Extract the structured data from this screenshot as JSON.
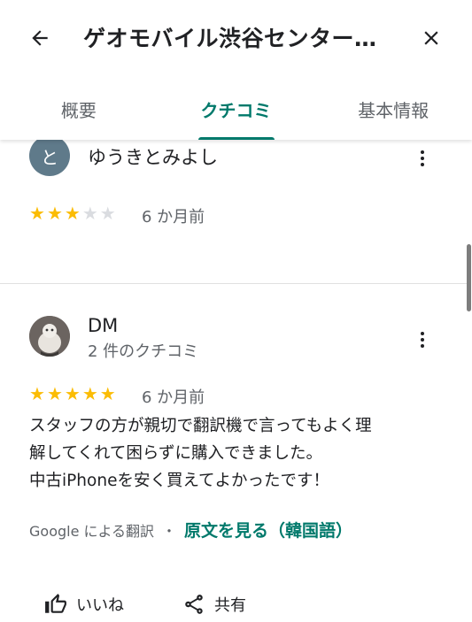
{
  "header": {
    "title": "ゲオモバイル渋谷センター…"
  },
  "tabs": [
    {
      "label": "概要"
    },
    {
      "label": "クチコミ"
    },
    {
      "label": "基本情報"
    }
  ],
  "reviews": [
    {
      "avatar_letter": "と",
      "name": "ゆうきとみよし",
      "rating": 3,
      "max_rating": 5,
      "time": "6 か月前"
    },
    {
      "avatar_icon": "profile-photo",
      "name": "DM",
      "review_count": "2 件のクチコミ",
      "rating": 5,
      "max_rating": 5,
      "time": "6 か月前",
      "text_lines": [
        "スタッフの方が親切で翻訳機で言ってもよく理",
        "解してくれて困らずに購入できました。",
        "中古iPhoneを安く買えてよかったです！"
      ],
      "translation_note": "Google による翻訳",
      "separator": "・",
      "original_link": "原文を見る（韓国語）"
    }
  ],
  "actions": {
    "like_label": "いいね",
    "share_label": "共有"
  },
  "colors": {
    "accent": "#00796b",
    "star": "#fbbc04",
    "star_empty": "#dadce0"
  }
}
